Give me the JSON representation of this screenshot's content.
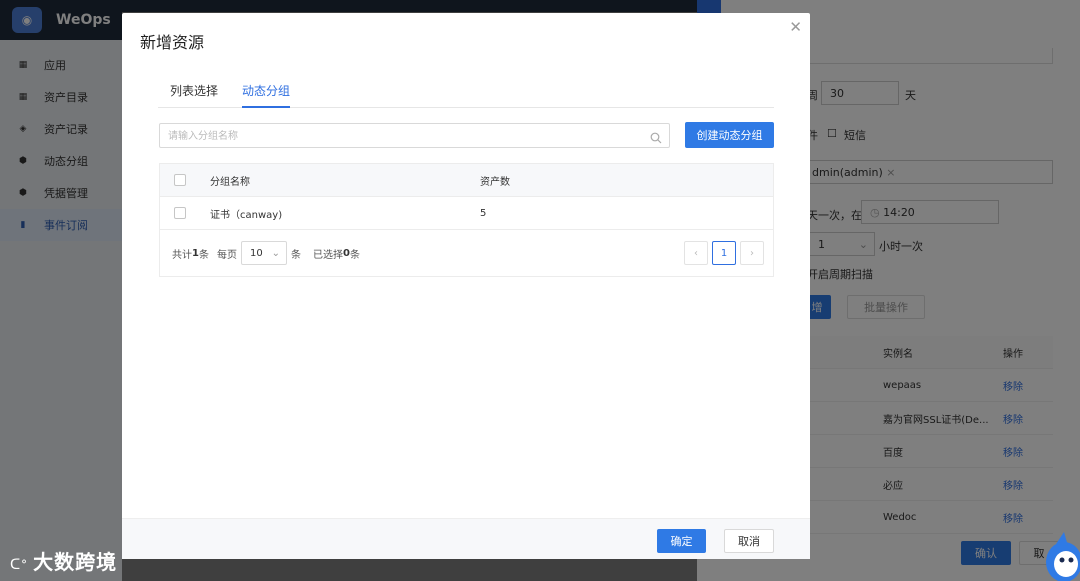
{
  "app": {
    "brand": "WeOps",
    "logo_icon": "robot-icon",
    "sidebar": [
      {
        "label": "应用",
        "icon": "grid-icon"
      },
      {
        "label": "资产目录",
        "icon": "grid-icon"
      },
      {
        "label": "资产记录",
        "icon": "layers-icon"
      },
      {
        "label": "动态分组",
        "icon": "shield-icon"
      },
      {
        "label": "凭据管理",
        "icon": "shield-icon"
      },
      {
        "label": "事件订阅",
        "icon": "bookmark-icon",
        "active": true
      }
    ]
  },
  "right_panel": {
    "days_prefix": "周",
    "days_value": "30",
    "days_unit": "天",
    "notify_email": "件",
    "notify_sms": "短信",
    "receiver": "dmin(admin)",
    "schedule_text": "天一次，在",
    "time_value": "14:20",
    "hour_value": "1",
    "hour_suffix": "小时一次",
    "scan_text": "开启周期扫描",
    "add_btn": "增",
    "batch_btn": "批量操作",
    "col_instance": "实例名",
    "col_action": "操作",
    "rows": [
      {
        "name": "wepaas",
        "action": "移除"
      },
      {
        "name": "嘉为官网SSL证书(De...",
        "action": "移除"
      },
      {
        "name": "百度",
        "action": "移除"
      },
      {
        "name": "必应",
        "action": "移除"
      },
      {
        "name": "Wedoc",
        "action": "移除"
      }
    ],
    "confirm": "确认",
    "cancel": "取"
  },
  "modal": {
    "title": "新增资源",
    "close_icon": "close-icon",
    "tabs": [
      {
        "label": "列表选择",
        "active": false
      },
      {
        "label": "动态分组",
        "active": true
      }
    ],
    "search": {
      "placeholder": "请输入分组名称",
      "value": ""
    },
    "create_button": "创建动态分组",
    "table": {
      "headers": [
        "分组名称",
        "资产数"
      ],
      "rows": [
        {
          "name": "证书（canway)",
          "count": "5"
        }
      ]
    },
    "pagination": {
      "total_prefix": "共计",
      "total": "1",
      "total_suffix": "条",
      "per_page_label": "每页",
      "page_size": "10",
      "per_page_unit": "条",
      "selected_prefix": "已选择",
      "selected": "0",
      "selected_suffix": "条",
      "current_page": "1"
    },
    "ok_button": "确定",
    "cancel_button": "取消"
  },
  "watermark": "大数跨境",
  "colors": {
    "primary": "#2f7ae5",
    "sidebar_dark": "#1f2a3a"
  }
}
